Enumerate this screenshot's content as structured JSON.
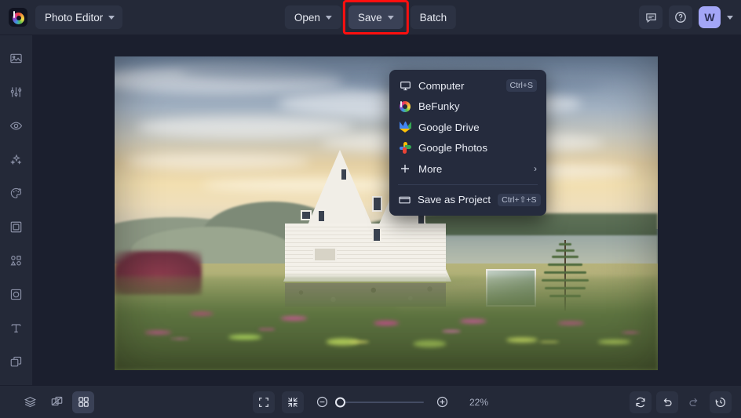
{
  "app": {
    "brand_icon": "befunky-logo-icon",
    "mode_label": "Photo Editor",
    "accent_color": "#a3a6f7",
    "highlight_color": "#ff0f0f",
    "menu_bg": "#252b3d",
    "chrome_bg": "#242938",
    "canvas_bg": "#1b1f2e"
  },
  "toolbar": {
    "open_label": "Open",
    "save_label": "Save",
    "batch_label": "Batch",
    "feedback_icon": "chat-bubble-icon",
    "help_icon": "question-mark-circle-icon",
    "avatar_initial": "W"
  },
  "sidebar": {
    "items": [
      {
        "name": "image-manager",
        "icon": "image-icon"
      },
      {
        "name": "edit",
        "icon": "sliders-icon"
      },
      {
        "name": "touch-up",
        "icon": "eye-icon"
      },
      {
        "name": "ai-effects",
        "icon": "sparkles-icon"
      },
      {
        "name": "artsy",
        "icon": "palette-icon"
      },
      {
        "name": "frames",
        "icon": "frame-icon"
      },
      {
        "name": "graphics",
        "icon": "shapes-icon"
      },
      {
        "name": "overlays",
        "icon": "overlay-icon"
      },
      {
        "name": "text",
        "icon": "text-t-icon"
      },
      {
        "name": "layers",
        "icon": "layers-stack-icon"
      }
    ]
  },
  "save_menu": {
    "items": [
      {
        "label": "Computer",
        "icon": "monitor-icon",
        "shortcut": "Ctrl+S",
        "has_submenu": false
      },
      {
        "label": "BeFunky",
        "icon": "befunky-logo-icon",
        "shortcut": "",
        "has_submenu": false
      },
      {
        "label": "Google Drive",
        "icon": "google-drive-icon",
        "shortcut": "",
        "has_submenu": false
      },
      {
        "label": "Google Photos",
        "icon": "google-photos-icon",
        "shortcut": "",
        "has_submenu": false
      },
      {
        "label": "More",
        "icon": "plus-icon",
        "shortcut": "",
        "has_submenu": true
      }
    ],
    "submenu_arrow": "›",
    "project": {
      "label": "Save as Project",
      "icon": "folder-icon",
      "shortcut": "Ctrl+⇧+S"
    }
  },
  "bottombar": {
    "layers_icon": "layers-stack-icon",
    "compare_icon": "compare-split-icon",
    "grid_icon": "grid-four-icon",
    "fit_icon": "expand-corners-icon",
    "shrink_icon": "collapse-corners-icon",
    "zoom_out_icon": "minus-circle-icon",
    "zoom_in_icon": "plus-circle-icon",
    "zoom_level": "22%",
    "zoom_slider_percent": 0,
    "reset_icon": "reset-circular-arrow-icon",
    "undo_icon": "undo-arrow-icon",
    "redo_icon": "redo-arrow-icon",
    "history_icon": "history-clock-icon"
  },
  "canvas": {
    "photo_alt": "White A-frame house on a lakeside lawn with pink flower beds at sunrise"
  }
}
